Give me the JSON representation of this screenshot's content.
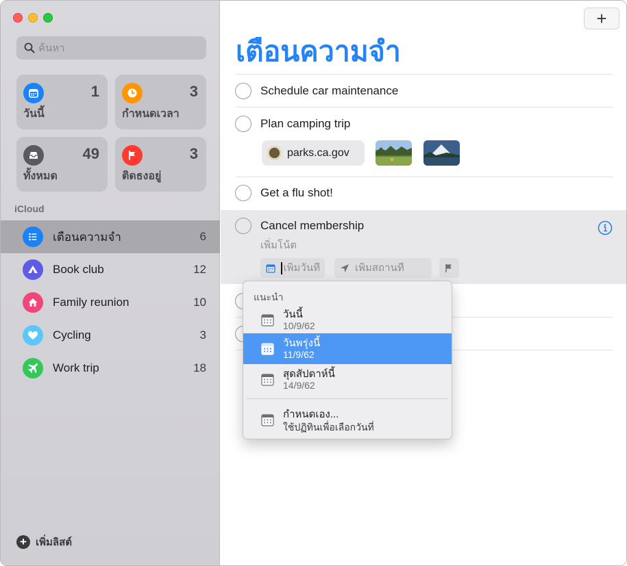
{
  "sidebar": {
    "search_placeholder": "ค้นหา",
    "smart_lists": [
      {
        "label": "วันนี้",
        "count": "1",
        "color": "#1a82fb",
        "icon": "calendar-icon"
      },
      {
        "label": "กำหนดเวลา",
        "count": "3",
        "color": "#ff9500",
        "icon": "clock-icon"
      },
      {
        "label": "ทั้งหมด",
        "count": "49",
        "color": "#5a5a5e",
        "icon": "tray-icon"
      },
      {
        "label": "ติดธงอยู่",
        "count": "3",
        "color": "#ff3b30",
        "icon": "flag-icon"
      }
    ],
    "section": "iCloud",
    "lists": [
      {
        "name": "เตือนความจำ",
        "count": "6",
        "color": "#1a82fb",
        "icon": "list-icon"
      },
      {
        "name": "Book club",
        "count": "12",
        "color": "#5e5ce6",
        "icon": "tent-icon"
      },
      {
        "name": "Family reunion",
        "count": "10",
        "color": "#f2457a",
        "icon": "house-icon"
      },
      {
        "name": "Cycling",
        "count": "3",
        "color": "#5ac8fa",
        "icon": "heart-icon"
      },
      {
        "name": "Work trip",
        "count": "18",
        "color": "#34c759",
        "icon": "airplane-icon"
      }
    ],
    "add_list_label": "เพิ่มลิสต์"
  },
  "main": {
    "add_button": "+",
    "title": "เตือนความจำ",
    "accent": "#2483f5",
    "reminders": [
      {
        "title": "Schedule car maintenance"
      },
      {
        "title": "Plan camping trip"
      },
      {
        "title": "Get a flu shot!"
      },
      {
        "title": "Cancel membership"
      }
    ],
    "link_chip": "parks.ca.gov",
    "note_placeholder": "เพิ่มโน้ต",
    "date_placeholder": "เพิ่มวันที่",
    "location_placeholder": "เพิ่มสถานที่"
  },
  "popup": {
    "header": "แนะนำ",
    "options": [
      {
        "title": "วันนี้",
        "date": "10/9/62"
      },
      {
        "title": "วันพรุ่งนี้",
        "date": "11/9/62"
      },
      {
        "title": "สุดสัปดาห์นี้",
        "date": "14/9/62"
      }
    ],
    "custom": {
      "title": "กำหนดเอง...",
      "subtitle": "ใช้ปฏิทินเพื่อเลือกวันที่"
    }
  }
}
